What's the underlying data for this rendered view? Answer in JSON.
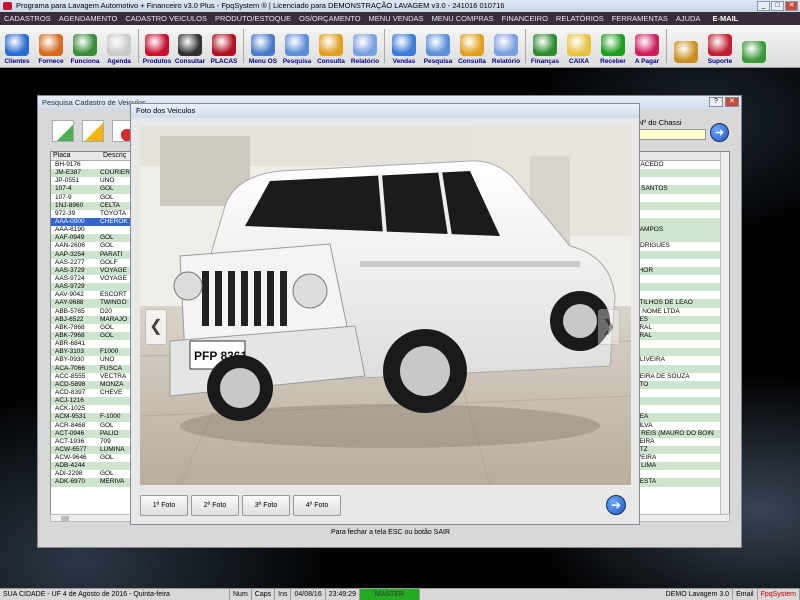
{
  "window": {
    "title": "Programa para Lavagem Automotivo + Financeiro v3.0 Plus - FpqSystem ® | Licenciado para  DEMONSTRAÇÃO LAVAGEM v3.0 - 241016 010716",
    "buttons": [
      "_",
      "□",
      "✕"
    ]
  },
  "menubar": [
    "CADASTROS",
    "AGENDAMENTO",
    "CADASTRO VEICULOS",
    "PRODUTO/ESTOQUE",
    "OS/ORÇAMENTO",
    "MENU VENDAS",
    "MENU COMPRAS",
    "FINANCEIRO",
    "RELATÓRIOS",
    "FERRAMENTAS",
    "AJUDA",
    "E-MAIL"
  ],
  "toolbar": [
    {
      "label": "Clientes",
      "color": "#2a6bd1"
    },
    {
      "label": "Fornece",
      "color": "#d66a1e"
    },
    {
      "label": "Funciona",
      "color": "#3a8c3a"
    },
    {
      "label": "Agenda",
      "color": "#c9c9c9"
    },
    {
      "label": "Produtos",
      "color": "#c8102e"
    },
    {
      "label": "Consultar",
      "color": "#333333"
    },
    {
      "label": "PLACAS",
      "color": "#b01020"
    },
    {
      "label": "Menu OS",
      "color": "#4a7ac8"
    },
    {
      "label": "Pesquisa",
      "color": "#5b8fd8"
    },
    {
      "label": "Consulta",
      "color": "#e0a020"
    },
    {
      "label": "Relatório",
      "color": "#7aa0e0"
    },
    {
      "label": "Vendas",
      "color": "#3d7bd6"
    },
    {
      "label": "Pesquisa",
      "color": "#5b8fd8"
    },
    {
      "label": "Consulta",
      "color": "#e0a020"
    },
    {
      "label": "Relatório",
      "color": "#7aa0e0"
    },
    {
      "label": "Finanças",
      "color": "#2e8b2e"
    },
    {
      "label": "CAIXA",
      "color": "#e8c040"
    },
    {
      "label": "Receber",
      "color": "#1f9d1f"
    },
    {
      "label": "A Pagar",
      "color": "#d01f5f"
    },
    {
      "label": "",
      "color": "#c99020"
    },
    {
      "label": "Suporte",
      "color": "#c02030"
    },
    {
      "label": "",
      "color": "#3a9a3a"
    }
  ],
  "child_dialog": {
    "title": "Pesquisa Cadastro de Veiculos",
    "chassi_label": "Nº do Chassi",
    "footer_hint": "Para fechar a tela ESC ou botão SAIR",
    "columns": [
      "Placa",
      "Descriç"
    ],
    "rows": [
      [
        "BH-9176",
        ""
      ],
      [
        "JM-E387",
        "COURIER"
      ],
      [
        "JP-0551",
        "UNO"
      ],
      [
        "107-4",
        "GOL"
      ],
      [
        "107-9",
        "GOL"
      ],
      [
        "1NJ-8960",
        "CELTA"
      ],
      [
        "972-39",
        "TOYOTA"
      ],
      [
        "AAA-0000",
        "CHEROK"
      ],
      [
        "AAA-8190",
        ""
      ],
      [
        "AAF-0949",
        "GOL"
      ],
      [
        "AAN-2606",
        "GOL"
      ],
      [
        "AAP-3254",
        "PARATI"
      ],
      [
        "AAS-2277",
        "GOLF"
      ],
      [
        "AAS-3729",
        "VOYAGE"
      ],
      [
        "AAS-9724",
        "VOYAGE"
      ],
      [
        "AAS-9729",
        ""
      ],
      [
        "AAV-9042",
        "ESCORT"
      ],
      [
        "AAY-9688",
        "TWINGO"
      ],
      [
        "ABB-5765",
        "D20"
      ],
      [
        "ABJ-6522",
        "MARAJO"
      ],
      [
        "ABK-7868",
        "GOL"
      ],
      [
        "ABK-7968",
        "GOL"
      ],
      [
        "ABR-6841",
        ""
      ],
      [
        "ABY-3103",
        "F1000"
      ],
      [
        "ABY-0930",
        "UNO"
      ],
      [
        "ACA-7066",
        "FUSCA"
      ],
      [
        "ACC-8555",
        "VECTRA"
      ],
      [
        "ACD-5898",
        "MONZA"
      ],
      [
        "ACD-8397",
        "CHEVE"
      ],
      [
        "ACJ-1216",
        ""
      ],
      [
        "ACK-1025",
        ""
      ],
      [
        "ACM-9531",
        "F-1000"
      ],
      [
        "ACR-8468",
        "GOL"
      ],
      [
        "ACT-0946",
        "PALIO"
      ],
      [
        "ACT-1936",
        "709"
      ],
      [
        "ACW-6577",
        "LUMINA"
      ],
      [
        "ACW-9646",
        "GOL"
      ],
      [
        "ADB-4244",
        ""
      ],
      [
        "ADI-2298",
        "GOL"
      ],
      [
        "ADK-6970",
        "MERIVA"
      ]
    ],
    "right_rows": [
      "MACEDO",
      "",
      "",
      "S SANTOS",
      "A",
      "A",
      "",
      "",
      "CAMPOS",
      "",
      "ODRIGUES",
      "",
      "E",
      "LHOR",
      "",
      "",
      "",
      "STILHOS DE LEAO",
      "M NOME LTDA",
      "AES",
      "BRAL",
      "BRAL",
      "",
      "",
      "OLIVEIRA",
      "2",
      "REIRA DE SOUZA",
      "STO",
      "S",
      "",
      "",
      "REA",
      "SILVA",
      "S REIS  (MAURO DO BOIN",
      "VEIRA",
      "NTZ",
      "IVEIRA",
      "E LIMA",
      "",
      "RESTA"
    ],
    "selected_row": 7
  },
  "photo_modal": {
    "title": "Foto dos Veiculos",
    "plate_text": "PFP 8361",
    "buttons": [
      "1ª Foto",
      "2ª Foto",
      "3ª Foto",
      "4ª Foto"
    ]
  },
  "statusbar": [
    "SUA CIDADE - UF  4 de Agosto de 2016 - Quinta-feira",
    "Num",
    "Caps",
    "Ins",
    "04/08/16",
    "23:49:29",
    "MASTER",
    "DEMO Lavagem 3.0",
    "Email",
    "FpqSystem"
  ]
}
